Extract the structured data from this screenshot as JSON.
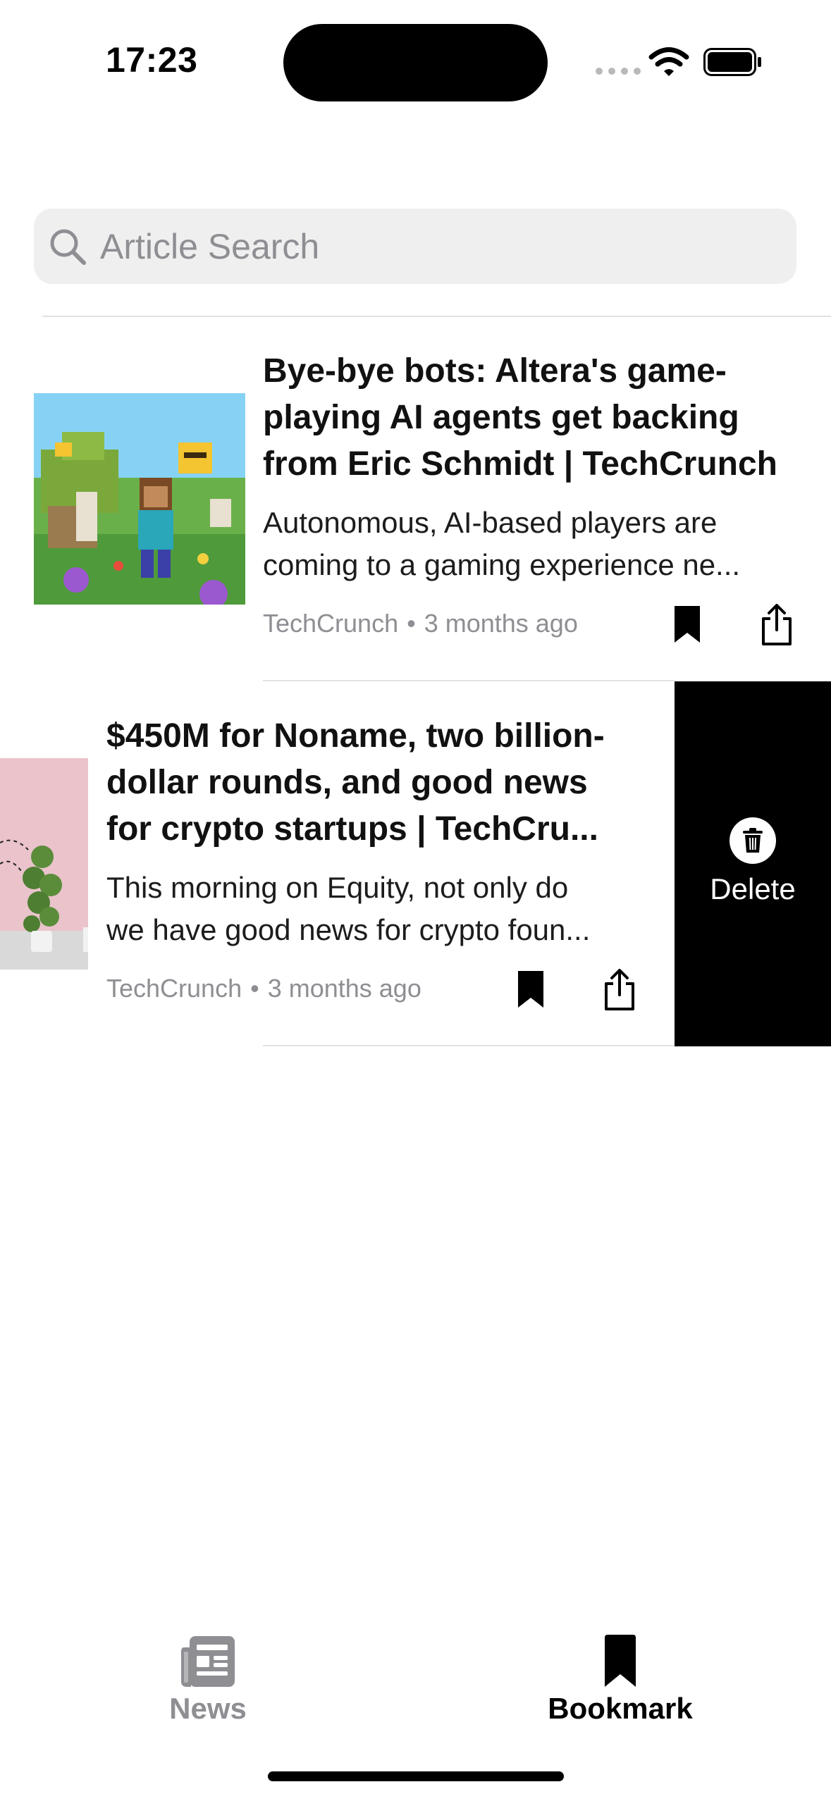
{
  "status_bar": {
    "time": "17:23"
  },
  "search": {
    "placeholder": "Article Search",
    "value": ""
  },
  "articles": [
    {
      "headline_lines": [
        "Bye-bye bots: Altera's game-",
        "playing AI agents get backing",
        "from Eric Schmidt | TechCrunch"
      ],
      "summary_lines": [
        "Autonomous, AI-based players are",
        "coming to a gaming experience ne..."
      ],
      "source": "TechCrunch",
      "separator": "•",
      "time": "3 months ago"
    },
    {
      "headline_lines": [
        "$450M for Noname, two billion-",
        "dollar rounds, and good news",
        "for crypto startups | TechCru..."
      ],
      "summary_lines": [
        "This morning on Equity, not only do",
        "we have good news for crypto foun..."
      ],
      "source": "TechCrunch",
      "separator": "•",
      "time": "3 months ago",
      "swipe_action": "Delete"
    }
  ],
  "tabs": [
    {
      "label": "News",
      "icon": "newspaper-icon",
      "selected": false
    },
    {
      "label": "Bookmark",
      "icon": "bookmark-icon",
      "selected": true
    }
  ],
  "colors": {
    "accent": "#000000",
    "inactive_tab": "#8e8e93",
    "delete_background": "#000000",
    "search_background": "#efefef"
  }
}
